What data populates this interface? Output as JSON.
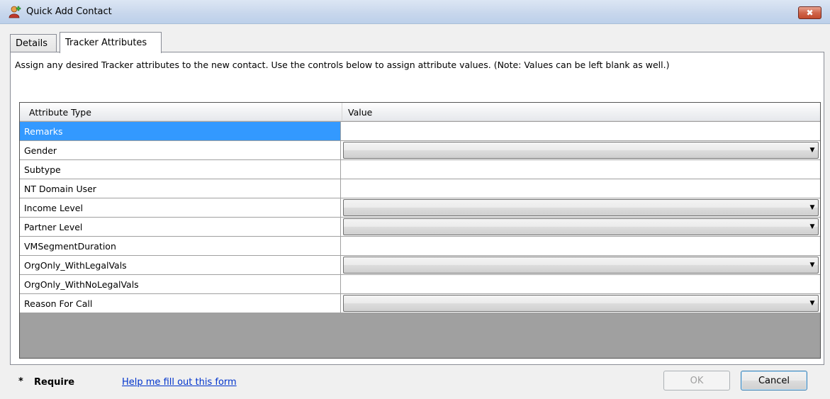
{
  "window": {
    "title": "Quick Add Contact",
    "close_glyph": "✖"
  },
  "tabs": [
    {
      "label": "Details",
      "active": false
    },
    {
      "label": "Tracker Attributes",
      "active": true
    }
  ],
  "instructions": "Assign any desired Tracker attributes to the new contact.  Use the controls below to assign attribute values.  (Note: Values can be left blank as well.)",
  "grid": {
    "columns": [
      "Attribute Type",
      "Value"
    ],
    "rows": [
      {
        "attribute": "Remarks",
        "value_type": "text",
        "value": "",
        "selected": true
      },
      {
        "attribute": "Gender",
        "value_type": "dropdown",
        "value": ""
      },
      {
        "attribute": "Subtype",
        "value_type": "text",
        "value": ""
      },
      {
        "attribute": "NT Domain User",
        "value_type": "text",
        "value": ""
      },
      {
        "attribute": "Income Level",
        "value_type": "dropdown",
        "value": ""
      },
      {
        "attribute": "Partner Level",
        "value_type": "dropdown",
        "value": ""
      },
      {
        "attribute": "VMSegmentDuration",
        "value_type": "text",
        "value": ""
      },
      {
        "attribute": "OrgOnly_WithLegalVals",
        "value_type": "dropdown",
        "value": ""
      },
      {
        "attribute": "OrgOnly_WithNoLegalVals",
        "value_type": "text",
        "value": ""
      },
      {
        "attribute": "Reason For Call",
        "value_type": "dropdown",
        "value": ""
      }
    ]
  },
  "footer": {
    "required_marker": "*",
    "required_label": "Require",
    "help_link": "Help me fill out this form",
    "ok_label": "OK",
    "cancel_label": "Cancel"
  },
  "icons": {
    "app": "contact-add-icon",
    "close": "close-icon",
    "dropdown": "chevron-down-icon"
  },
  "colors": {
    "selection": "#3399ff",
    "link": "#0033cc",
    "close_button": "#c24a2c"
  }
}
